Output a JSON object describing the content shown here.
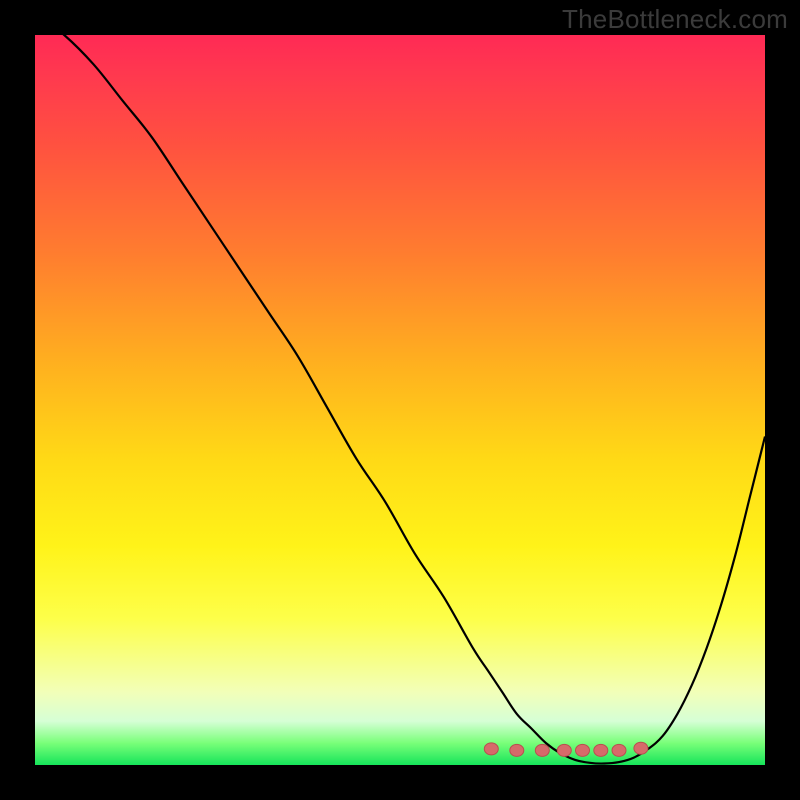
{
  "watermark": "TheBottleneck.com",
  "colors": {
    "background": "#000000",
    "gradient_top": "#ff2a55",
    "gradient_bottom": "#16e45a",
    "curve": "#000000",
    "marker_fill": "#d66a6a",
    "marker_stroke": "#b84f4f"
  },
  "chart_data": {
    "type": "line",
    "title": "",
    "xlabel": "",
    "ylabel": "",
    "xlim": [
      0,
      100
    ],
    "ylim": [
      0,
      100
    ],
    "x": [
      0,
      4,
      8,
      12,
      16,
      20,
      24,
      28,
      32,
      36,
      40,
      44,
      48,
      52,
      56,
      60,
      62,
      64,
      66,
      68,
      70,
      72,
      74,
      76,
      78,
      80,
      82,
      84,
      86,
      88,
      90,
      92,
      94,
      96,
      98,
      100
    ],
    "values": [
      103,
      100,
      96,
      91,
      86,
      80,
      74,
      68,
      62,
      56,
      49,
      42,
      36,
      29,
      23,
      16,
      13,
      10,
      7,
      5,
      3,
      1.6,
      0.7,
      0.3,
      0.2,
      0.4,
      1.0,
      2.2,
      4.0,
      7.0,
      11,
      16,
      22,
      29,
      37,
      45
    ],
    "markers_x": [
      62.5,
      66.0,
      69.5,
      72.5,
      75.0,
      77.5,
      80.0,
      83.0
    ],
    "markers_y": [
      2.2,
      2.0,
      2.0,
      2.0,
      2.0,
      2.0,
      2.0,
      2.3
    ]
  }
}
